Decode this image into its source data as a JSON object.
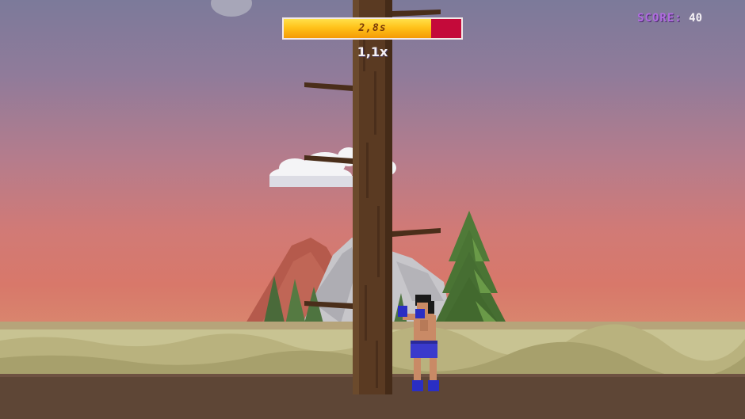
{
  "hud": {
    "timer_text": "2,8s",
    "timer_fraction": 0.83,
    "multiplier": "1,1x",
    "score_label": "SCORE:",
    "score_value": "40"
  },
  "colors": {
    "timer_fill": "#ffc21a",
    "timer_empty": "#c40a3a",
    "score_label": "#b06ce0",
    "trunk": "#5a3a22",
    "ground": "#5e4636"
  },
  "scene": {
    "character": "boxer",
    "character_shorts_color": "#3a3acc",
    "trunk_branches": [
      "right",
      "left",
      "left",
      "right",
      "left"
    ]
  }
}
